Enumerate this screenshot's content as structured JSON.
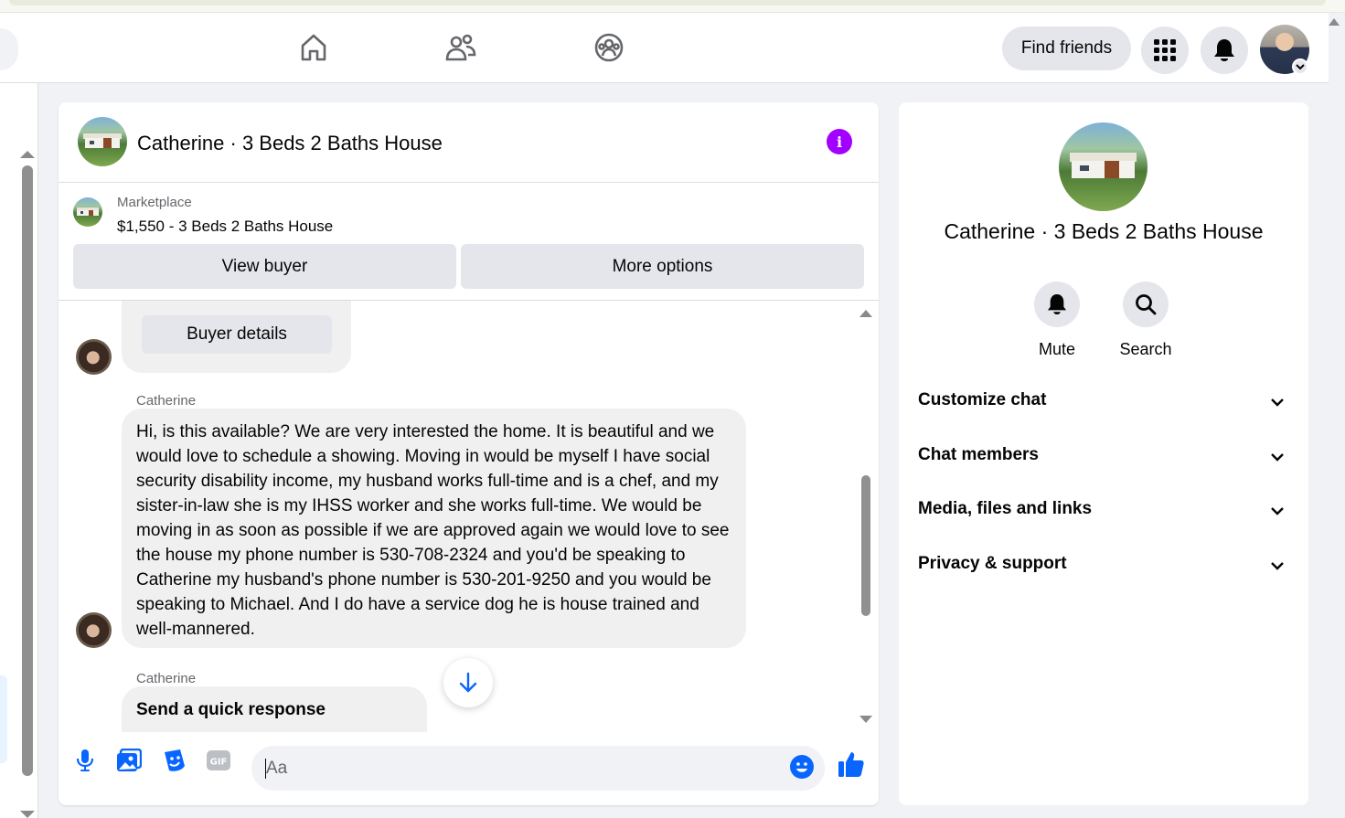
{
  "topbar": {
    "nav": [
      {
        "name": "home-icon"
      },
      {
        "name": "friends-icon"
      },
      {
        "name": "groups-icon"
      }
    ],
    "find_friends_label": "Find friends",
    "menu_icon": "grid-menu-icon",
    "notifications_icon": "bell-icon",
    "profile_icon": "profile-avatar"
  },
  "chat": {
    "title": "Catherine · 3 Beds 2 Baths House",
    "info_icon": "info-icon",
    "marketplace": {
      "label": "Marketplace",
      "listing": "$1,550 - 3 Beds 2 Baths House",
      "view_buyer_label": "View buyer",
      "more_options_label": "More options"
    },
    "messages": [
      {
        "type": "buyer_card",
        "button_label": "Buyer details"
      },
      {
        "sender": "Catherine",
        "text": "Hi, is this available? We are very interested the home. It is beautiful and we would love to schedule a showing. Moving in would be myself I have social security disability income, my husband works full-time and is a chef, and my sister-in-law she is my IHSS worker and she works full-time. We would be moving in as soon as possible if we are approved again we would love to see the house my phone number is 530-708-2324 and you'd be speaking to Catherine my husband's phone number is 530-201-9250 and you would be speaking to Michael. And I do have a service dog he is house trained and well-mannered."
      },
      {
        "sender": "Catherine",
        "text": "Send a quick response"
      }
    ],
    "composer": {
      "placeholder": "Aa",
      "icons": [
        "microphone-icon",
        "photo-icon",
        "sticker-icon",
        "gif-icon",
        "emoji-icon",
        "like-icon"
      ],
      "gif_label": "GIF"
    }
  },
  "info_panel": {
    "title": "Catherine · 3 Beds 2 Baths House",
    "actions": [
      {
        "label": "Mute",
        "icon": "bell-icon"
      },
      {
        "label": "Search",
        "icon": "search-icon"
      }
    ],
    "sections": [
      {
        "label": "Customize chat"
      },
      {
        "label": "Chat members"
      },
      {
        "label": "Media, files and links"
      },
      {
        "label": "Privacy & support"
      }
    ]
  },
  "colors": {
    "accent": "#0866ff",
    "info_purple": "#a200ff",
    "bubble": "#f0f0f0",
    "button_gray": "#e4e6eb"
  }
}
